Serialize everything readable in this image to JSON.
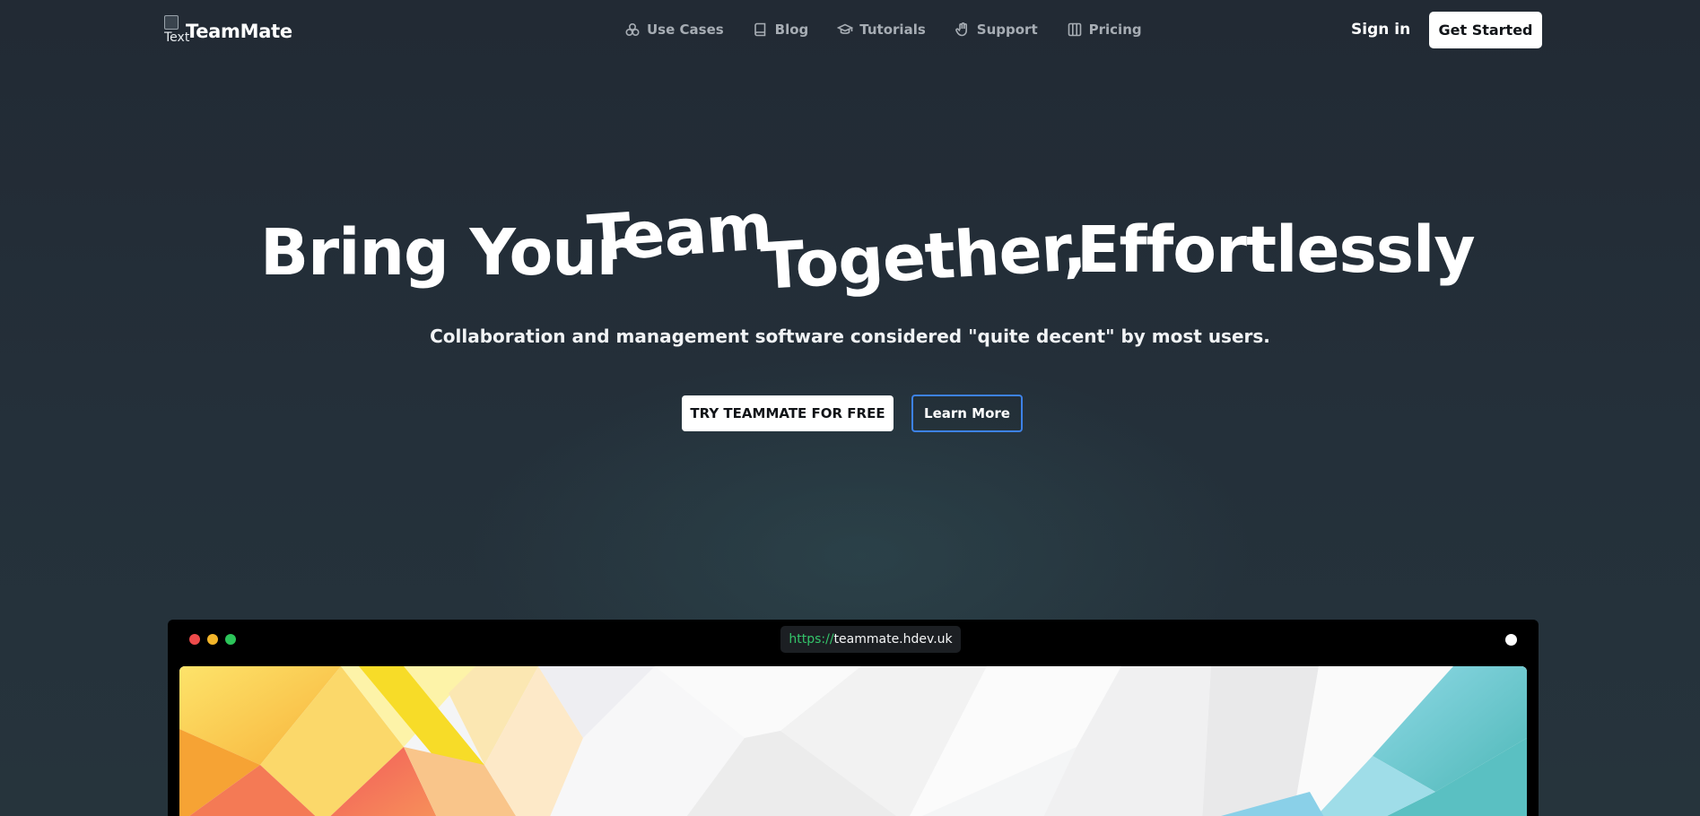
{
  "header": {
    "logo_alt": "Text",
    "brand": "TeamMate",
    "nav": [
      {
        "label": "Use Cases",
        "icon": "circles-icon"
      },
      {
        "label": "Blog",
        "icon": "book-icon"
      },
      {
        "label": "Tutorials",
        "icon": "graduation-cap-icon"
      },
      {
        "label": "Support",
        "icon": "hand-icon"
      },
      {
        "label": "Pricing",
        "icon": "columns-icon"
      }
    ],
    "sign_in": "Sign in",
    "get_started": "Get Started"
  },
  "hero": {
    "headline_words": [
      "Bring Your",
      "Team",
      "Together,",
      "Effortlessly"
    ],
    "subtitle": "Collaboration and management software considered \"quite decent\" by most users.",
    "cta_primary": "TRY TEAMMATE FOR FREE",
    "cta_secondary": "Learn More"
  },
  "browser": {
    "url_scheme": "https://",
    "url_host": "teammate.hdev.uk"
  },
  "colors": {
    "background": "#222a34",
    "button_outline": "#3d82e8",
    "url_scheme": "#34c46a"
  }
}
